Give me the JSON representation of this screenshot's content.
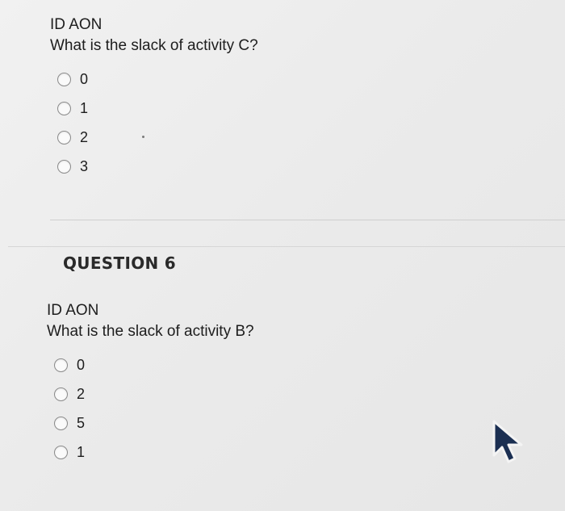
{
  "question5": {
    "line1": "ID AON",
    "prompt": "What is the slack of activity C?",
    "options": [
      "0",
      "1",
      "2",
      "3"
    ]
  },
  "question6": {
    "heading": "QUESTION 6",
    "line1": "ID AON",
    "prompt": "What is the slack of activity B?",
    "options": [
      "0",
      "2",
      "5",
      "1"
    ]
  },
  "icons": {
    "cursor": "mouse-pointer-icon",
    "radio": "radio-unselected-icon"
  }
}
